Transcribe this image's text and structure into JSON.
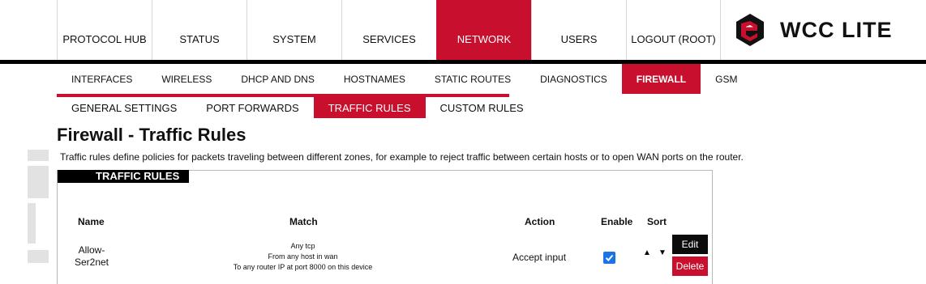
{
  "top_nav": {
    "items": [
      {
        "label": "PROTOCOL HUB",
        "active": false
      },
      {
        "label": "STATUS",
        "active": false
      },
      {
        "label": "SYSTEM",
        "active": false
      },
      {
        "label": "SERVICES",
        "active": false
      },
      {
        "label": "NETWORK",
        "active": true
      },
      {
        "label": "USERS",
        "active": false
      },
      {
        "label": "LOGOUT (ROOT)",
        "active": false
      }
    ]
  },
  "brand": {
    "name": "WCC LITE",
    "logo_icon": "wcc-logo-icon"
  },
  "sub_nav": {
    "items": [
      {
        "label": "INTERFACES",
        "active": false
      },
      {
        "label": "WIRELESS",
        "active": false
      },
      {
        "label": "DHCP AND DNS",
        "active": false
      },
      {
        "label": "HOSTNAMES",
        "active": false
      },
      {
        "label": "STATIC ROUTES",
        "active": false
      },
      {
        "label": "DIAGNOSTICS",
        "active": false
      },
      {
        "label": "FIREWALL",
        "active": true
      },
      {
        "label": "GSM",
        "active": false
      }
    ]
  },
  "tabs": {
    "items": [
      {
        "label": "GENERAL SETTINGS",
        "active": false
      },
      {
        "label": "PORT FORWARDS",
        "active": false
      },
      {
        "label": "TRAFFIC RULES",
        "active": true
      },
      {
        "label": "CUSTOM RULES",
        "active": false
      }
    ]
  },
  "page": {
    "title": "Firewall - Traffic Rules",
    "description": "Traffic rules define policies for packets traveling between different zones, for example to reject traffic between certain hosts or to open WAN ports on the router."
  },
  "section": {
    "title": "TRAFFIC RULES",
    "columns": {
      "name": "Name",
      "match": "Match",
      "action": "Action",
      "enable": "Enable",
      "sort": "Sort"
    },
    "rows": [
      {
        "name_line1": "Allow-",
        "name_line2": "Ser2net",
        "match_line1": "Any tcp",
        "match_line2": "From any host in wan",
        "match_line3": "To any router IP at port 8000 on this device",
        "action": "Accept input",
        "enabled": true,
        "edit_label": "Edit",
        "delete_label": "Delete"
      }
    ]
  },
  "colors": {
    "accent": "#c8102e",
    "dark": "#000000",
    "checkbox": "#1a73e8"
  }
}
